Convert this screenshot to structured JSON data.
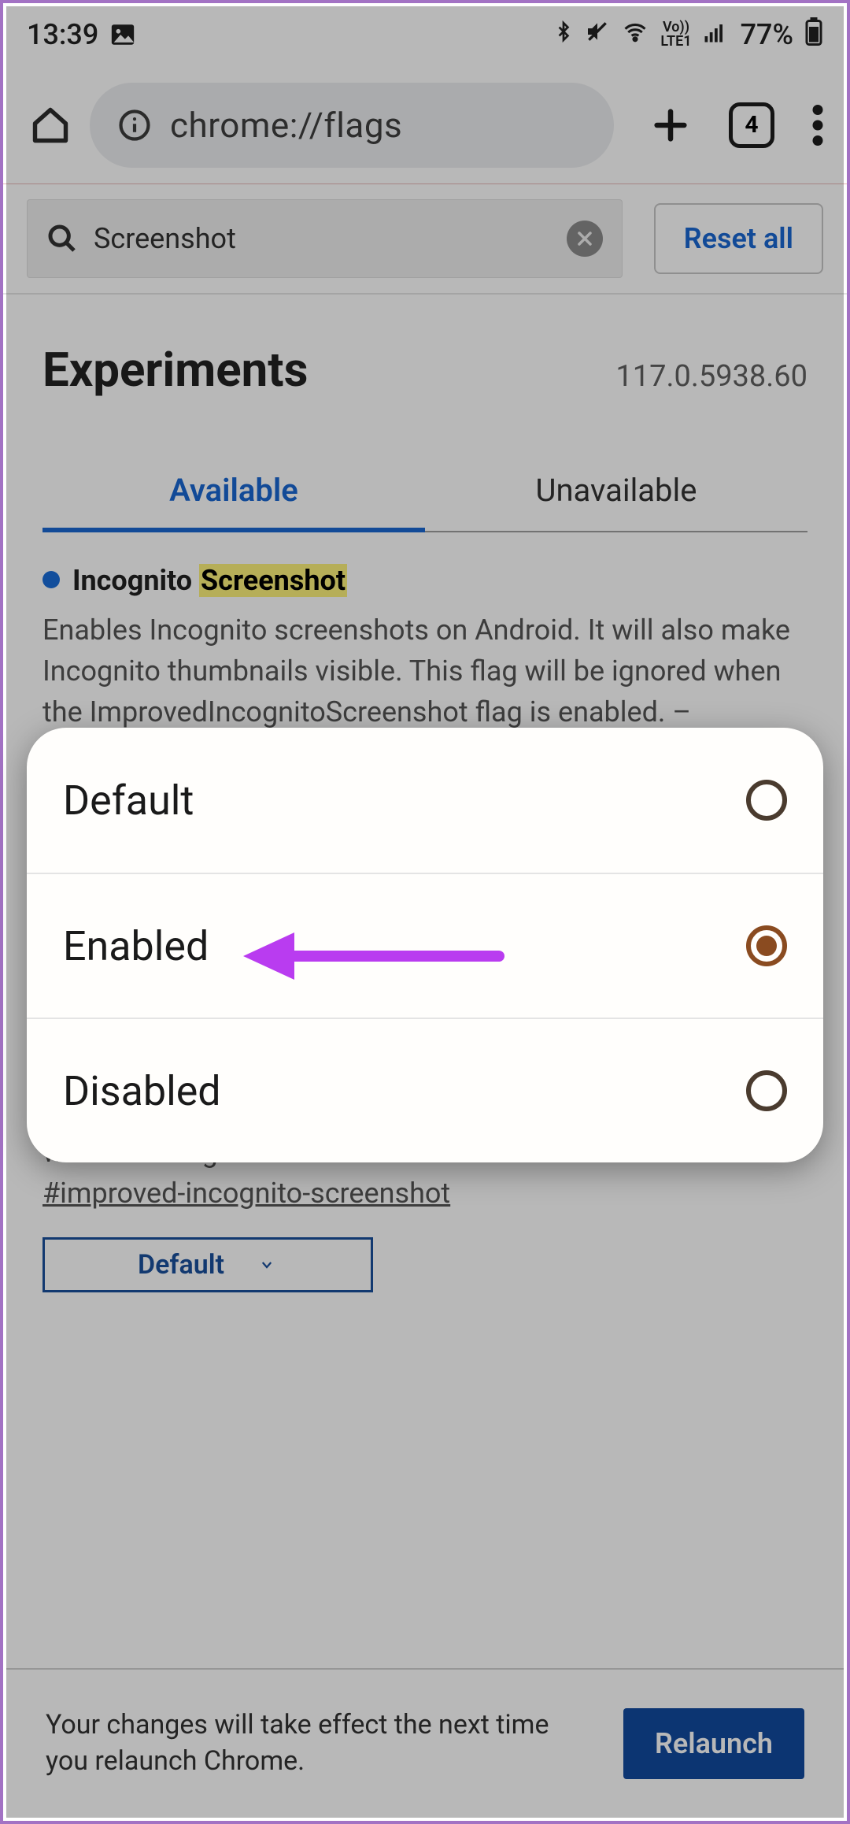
{
  "statusbar": {
    "time": "13:39",
    "battery": "77%"
  },
  "omnibox": {
    "url": "chrome://flags",
    "tab_count": "4"
  },
  "flags_search": {
    "value": "Screenshot",
    "reset_label": "Reset all"
  },
  "experiments": {
    "title": "Experiments",
    "version": "117.0.5938.60",
    "tabs": {
      "available": "Available",
      "unavailable": "Unavailable"
    }
  },
  "flag1": {
    "title_pre": "Incognito ",
    "title_hl": "Screenshot",
    "desc": "Enables Incognito screenshots on Android. It will also make Incognito thumbnails visible. This flag will be ignored when the ImprovedIncognitoScreenshot flag is enabled. –"
  },
  "flag2": {
    "desc_tail": "when this flag is enabled. – Android",
    "tag": "#improved-incognito-screenshot",
    "select_value": "Default"
  },
  "popup": {
    "options": {
      "default": "Default",
      "enabled": "Enabled",
      "disabled": "Disabled"
    }
  },
  "footer": {
    "message": "Your changes will take effect the next time you relaunch Chrome.",
    "relaunch": "Relaunch"
  }
}
